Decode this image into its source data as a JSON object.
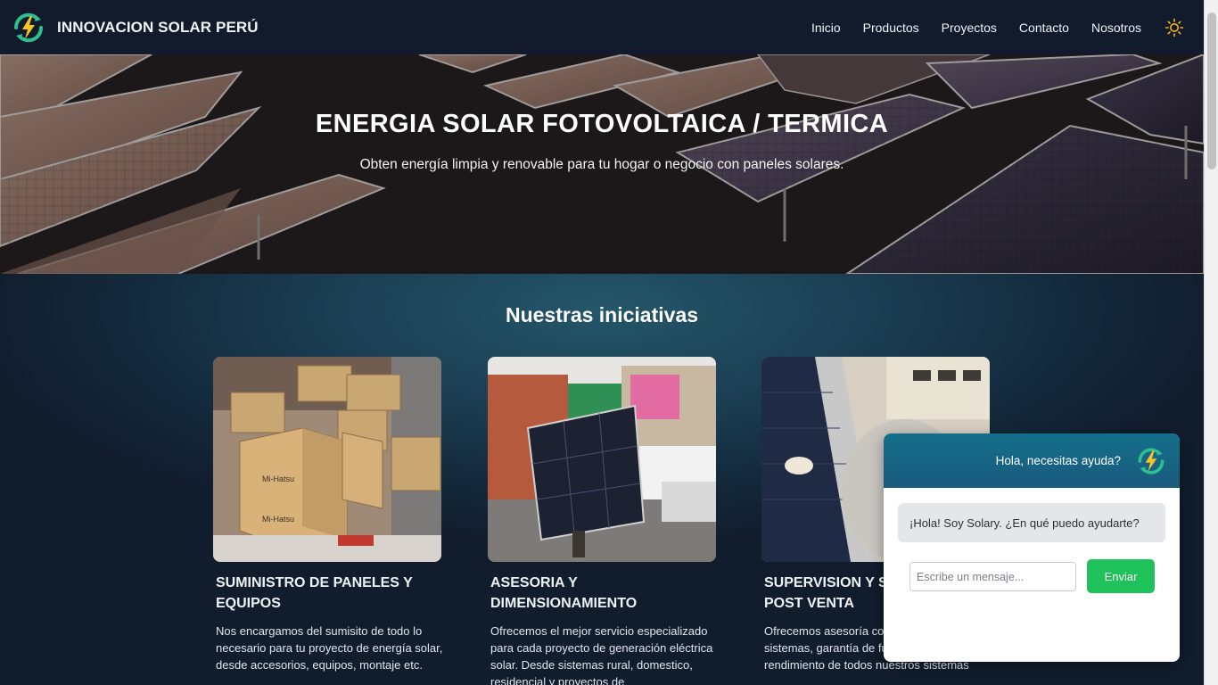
{
  "header": {
    "brand_name": "INNOVACION SOLAR PERÚ",
    "nav": [
      "Inicio",
      "Productos",
      "Proyectos",
      "Contacto",
      "Nosotros"
    ]
  },
  "hero": {
    "title": "ENERGIA SOLAR FOTOVOLTAICA / TERMICA",
    "subtitle": "Obten energía limpia y renovable para tu hogar o negocio con paneles solares."
  },
  "initiatives": {
    "title": "Nuestras iniciativas",
    "cards": [
      {
        "title": "SUMINISTRO DE PANELES Y EQUIPOS",
        "text": "Nos encargamos del sumisito de todo lo necesario para tu proyecto de energía solar, desde accesorios, equipos, montaje etc."
      },
      {
        "title": "ASESORIA Y DIMENSIONAMIENTO",
        "text": "Ofrecemos el mejor servicio especializado para cada proyecto de generación eléctrica solar. Desde sistemas rural, domestico, residencial y proyectos de"
      },
      {
        "title": "SUPERVISION Y SOPORTE POST VENTA",
        "text": "Ofrecemos asesoría con todos nuestros sistemas, garantía de funcionamiento y rendimiento de todos nuestros sistemas"
      }
    ]
  },
  "chat": {
    "header_title": "Hola, necesitas ayuda?",
    "bot_message": "¡Hola! Soy Solary. ¿En qué puedo ayudarte?",
    "input_placeholder": "Escribe un mensaje...",
    "send_label": "Enviar"
  },
  "colors": {
    "header_bg": "#111b2c",
    "accent_orange": "#e2502a",
    "send_green": "#1fc15a",
    "logo_green": "#2fbf8f",
    "logo_yellow": "#f3c623"
  },
  "icons": [
    "logo-icon",
    "sun-icon"
  ]
}
